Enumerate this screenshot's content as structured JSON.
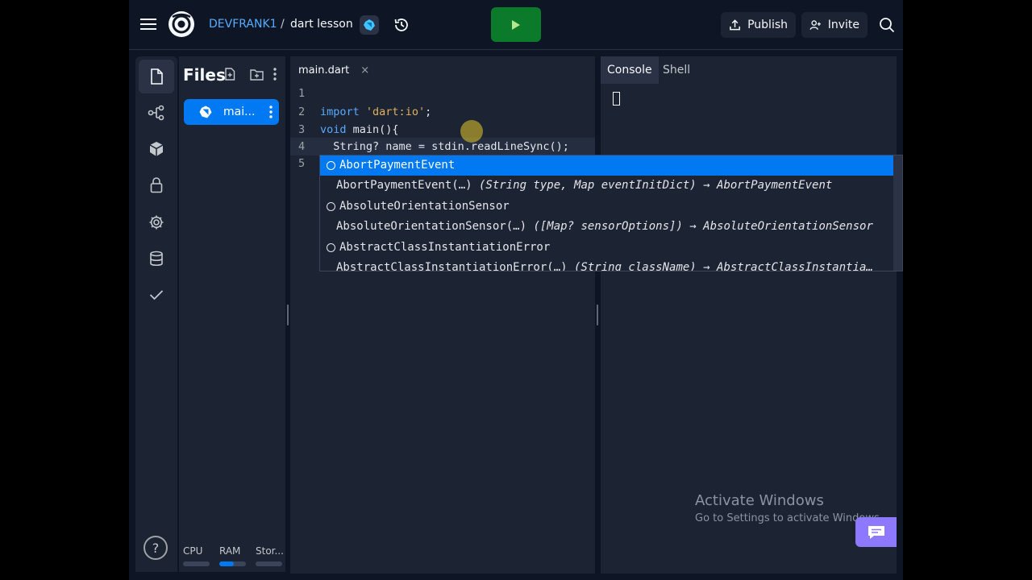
{
  "header": {
    "menu_icon": "hamburger-menu-icon",
    "logo": "replit-logo",
    "breadcrumb_user": "DEVFRANK1",
    "breadcrumb_sep": "/",
    "repl_name": "dart lesson",
    "lang_icon": "dart-icon",
    "history_icon": "history-icon",
    "run_icon": "play-icon",
    "publish_label": "Publish",
    "invite_label": "Invite",
    "search_icon": "search-icon"
  },
  "activity_bar": {
    "items": [
      {
        "icon": "files-icon",
        "active": true
      },
      {
        "icon": "git-icon",
        "active": false
      },
      {
        "icon": "packages-icon",
        "active": false
      },
      {
        "icon": "secrets-lock-icon",
        "active": false
      },
      {
        "icon": "settings-gear-icon",
        "active": false
      },
      {
        "icon": "database-icon",
        "active": false
      },
      {
        "icon": "checkmark-icon",
        "active": false
      }
    ],
    "help_label": "?"
  },
  "files_panel": {
    "title": "Files",
    "file": {
      "name": "mai...",
      "icon": "dart-icon"
    },
    "resources": [
      {
        "label": "CPU",
        "fill": 0.0
      },
      {
        "label": "RAM",
        "fill": 0.55
      },
      {
        "label": "Stor...",
        "fill": 0.0
      }
    ]
  },
  "editor": {
    "tab_label": "main.dart",
    "tab_close": "×",
    "lines": [
      {
        "num": "1",
        "code": ""
      },
      {
        "num": "2",
        "code": "import 'dart:io';"
      },
      {
        "num": "3",
        "code": "void main(){"
      },
      {
        "num": "4",
        "code": "  String? name = stdin.readLineSync();"
      },
      {
        "num": "5",
        "code": ""
      }
    ]
  },
  "autocomplete": {
    "items": [
      {
        "kind": "class",
        "name": "AbortPaymentEvent",
        "signature": ""
      },
      {
        "kind": "constructor",
        "name": "AbortPaymentEvent(…)",
        "signature": " (String type, Map eventInitDict) → AbortPaymentEvent"
      },
      {
        "kind": "class",
        "name": "AbsoluteOrientationSensor",
        "signature": ""
      },
      {
        "kind": "constructor",
        "name": "AbsoluteOrientationSensor(…)",
        "signature": " ([Map? sensorOptions]) → AbsoluteOrientationSensor"
      },
      {
        "kind": "class",
        "name": "AbstractClassInstantiationError",
        "signature": ""
      },
      {
        "kind": "constructor",
        "name": "AbstractClassInstantiationError(…)",
        "signature": " (String className) → AbstractClassInstantia…"
      }
    ]
  },
  "console": {
    "tabs": [
      "Console",
      "Shell"
    ],
    "active_tab": "Console",
    "watermark_title": "Activate Windows",
    "watermark_sub": "Go to Settings to activate Windows.",
    "chat_icon": "chat-bubble-icon"
  }
}
